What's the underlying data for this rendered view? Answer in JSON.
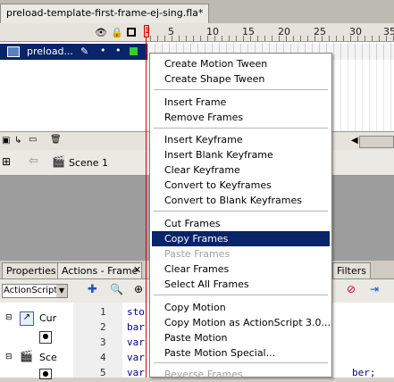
{
  "document": {
    "tab_title": "preload-template-first-frame-ej-sing.fla*"
  },
  "timeline": {
    "frame_numbers": [
      "1",
      "5",
      "10",
      "15",
      "20",
      "25",
      "30",
      "35"
    ],
    "layer_name": "preload...",
    "playhead_label": "1",
    "icons": [
      "eye-icon",
      "lock-icon",
      "outline-icon",
      "pencil-icon"
    ]
  },
  "edit_bar": {
    "scene_label": "Scene 1"
  },
  "panels": {
    "tabs": [
      "Properties",
      "Actions - Frame",
      "Filters"
    ],
    "script_version": "ActionScript",
    "tree_items": [
      "Cur",
      "Sce"
    ]
  },
  "code": {
    "line_numbers": [
      "1",
      "2",
      "3",
      "4",
      "5"
    ],
    "lines": [
      "sto",
      "bar",
      "var",
      "var",
      "var"
    ],
    "trailing": "ber;"
  },
  "context_menu": {
    "groups": [
      [
        "Create Motion Tween",
        "Create Shape Tween"
      ],
      [
        "Insert Frame",
        "Remove Frames"
      ],
      [
        "Insert Keyframe",
        "Insert Blank Keyframe",
        "Clear Keyframe",
        "Convert to Keyframes",
        "Convert to Blank Keyframes"
      ],
      [
        "Cut Frames",
        "Copy Frames",
        "Paste Frames",
        "Clear Frames",
        "Select All Frames"
      ],
      [
        "Copy Motion",
        "Copy Motion as ActionScript 3.0...",
        "Paste Motion",
        "Paste Motion Special..."
      ],
      [
        "Reverse Frames"
      ]
    ],
    "highlighted": "Copy Frames",
    "disabled": [
      "Paste Frames",
      "Reverse Frames"
    ]
  },
  "colors": {
    "selection": "#0a246a",
    "playhead": "#dd0000",
    "stage": "#9d9d9d"
  }
}
